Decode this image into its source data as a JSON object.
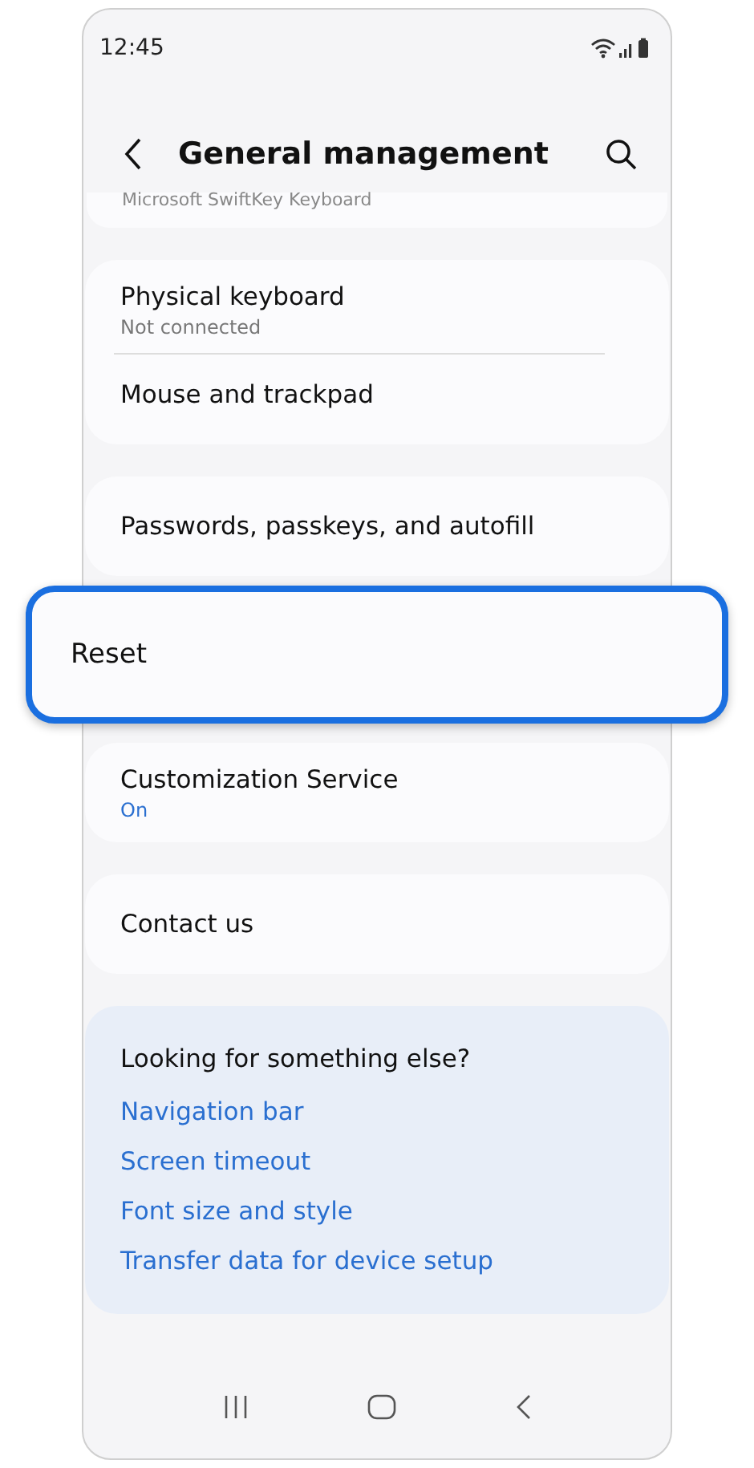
{
  "status_bar": {
    "time": "12:45"
  },
  "header": {
    "title": "General management"
  },
  "scrolled_item": {
    "subtitle": "Microsoft SwiftKey Keyboard"
  },
  "groups": [
    {
      "highlighted": false,
      "items": [
        {
          "title": "Physical keyboard",
          "subtitle": "Not connected",
          "color": "#777777"
        },
        {
          "title": "Mouse and trackpad"
        }
      ]
    },
    {
      "highlighted": false,
      "items": [
        {
          "title": "Passwords, passkeys, and autofill"
        }
      ]
    },
    {
      "highlighted": true,
      "items": [
        {
          "title": "Reset"
        }
      ]
    },
    {
      "highlighted": false,
      "items": [
        {
          "title": "Customization Service",
          "subtitle": "On",
          "color": "#2a6fd0"
        }
      ]
    },
    {
      "highlighted": false,
      "items": [
        {
          "title": "Contact us"
        }
      ]
    }
  ],
  "suggestions": {
    "title": "Looking for something else?",
    "links": [
      "Navigation bar",
      "Screen timeout",
      "Font size and style",
      "Transfer data for device setup"
    ]
  }
}
